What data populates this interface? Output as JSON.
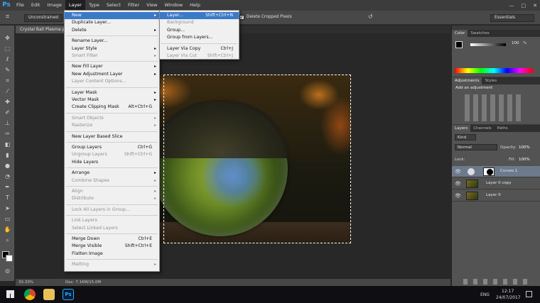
{
  "app": {
    "logo": "Ps"
  },
  "menubar": {
    "items": [
      "File",
      "Edit",
      "Image",
      "Layer",
      "Type",
      "Select",
      "Filter",
      "View",
      "Window",
      "Help"
    ],
    "window_controls": [
      "—",
      "□",
      "✕"
    ]
  },
  "options_bar": {
    "constrain_mode": "Unconstrained",
    "delete_cropped_label": "Delete Cropped Pixels",
    "workspace": "Essentials"
  },
  "document": {
    "tab_title": "Crystal Ball Plasma.ps..."
  },
  "status": {
    "zoom": "33.33%",
    "doc_info": "Doc: 7.16M/15.0M"
  },
  "layer_menu": {
    "items": [
      {
        "label": "New",
        "has_submenu": true,
        "highlight": true
      },
      {
        "label": "Duplicate Layer...",
        "has_submenu": false
      },
      {
        "label": "Delete",
        "has_submenu": true
      },
      {
        "sep": true
      },
      {
        "label": "Rename Layer...",
        "has_submenu": false
      },
      {
        "label": "Layer Style",
        "has_submenu": true
      },
      {
        "label": "Smart Filter",
        "has_submenu": true,
        "disabled": true
      },
      {
        "sep": true
      },
      {
        "label": "New Fill Layer",
        "has_submenu": true
      },
      {
        "label": "New Adjustment Layer",
        "has_submenu": true
      },
      {
        "label": "Layer Content Options...",
        "disabled": true
      },
      {
        "sep": true
      },
      {
        "label": "Layer Mask",
        "has_submenu": true
      },
      {
        "label": "Vector Mask",
        "has_submenu": true
      },
      {
        "label": "Create Clipping Mask",
        "shortcut": "Alt+Ctrl+G"
      },
      {
        "sep": true
      },
      {
        "label": "Smart Objects",
        "has_submenu": true,
        "disabled": true
      },
      {
        "label": "Rasterize",
        "has_submenu": true,
        "disabled": true
      },
      {
        "sep": true
      },
      {
        "label": "New Layer Based Slice"
      },
      {
        "sep": true
      },
      {
        "label": "Group Layers",
        "shortcut": "Ctrl+G"
      },
      {
        "label": "Ungroup Layers",
        "shortcut": "Shift+Ctrl+G",
        "disabled": true
      },
      {
        "label": "Hide Layers"
      },
      {
        "sep": true
      },
      {
        "label": "Arrange",
        "has_submenu": true
      },
      {
        "label": "Combine Shapes",
        "has_submenu": true,
        "disabled": true
      },
      {
        "sep": true
      },
      {
        "label": "Align",
        "has_submenu": true,
        "disabled": true
      },
      {
        "label": "Distribute",
        "has_submenu": true,
        "disabled": true
      },
      {
        "sep": true
      },
      {
        "label": "Lock All Layers in Group...",
        "disabled": true
      },
      {
        "sep": true
      },
      {
        "label": "Link Layers",
        "disabled": true
      },
      {
        "label": "Select Linked Layers",
        "disabled": true
      },
      {
        "sep": true
      },
      {
        "label": "Merge Down",
        "shortcut": "Ctrl+E"
      },
      {
        "label": "Merge Visible",
        "shortcut": "Shift+Ctrl+E"
      },
      {
        "label": "Flatten Image"
      },
      {
        "sep": true
      },
      {
        "label": "Matting",
        "has_submenu": true,
        "disabled": true
      }
    ]
  },
  "new_submenu": {
    "items": [
      {
        "label": "Layer...",
        "shortcut": "Shift+Ctrl+N",
        "highlight": true
      },
      {
        "label": "Background",
        "disabled": true
      },
      {
        "label": "Group..."
      },
      {
        "label": "Group from Layers..."
      },
      {
        "sep": true
      },
      {
        "label": "Layer Via Copy",
        "shortcut": "Ctrl+J"
      },
      {
        "label": "Layer Via Cut",
        "shortcut": "Shift+Ctrl+J",
        "disabled": true
      }
    ]
  },
  "color_panel": {
    "tabs": [
      "Color",
      "Swatches"
    ],
    "k_value": "100",
    "unit": "%"
  },
  "adjustments_panel": {
    "tabs": [
      "Adjustments",
      "Styles"
    ],
    "header": "Add an adjustment"
  },
  "layers_panel": {
    "tabs": [
      "Layers",
      "Channels",
      "Paths"
    ],
    "filter_kind": "Kind",
    "blend_mode": "Normal",
    "opacity_label": "Opacity:",
    "opacity_value": "100%",
    "lock_label": "Lock:",
    "fill_label": "Fill:",
    "fill_value": "100%",
    "layers": [
      {
        "name": "Curves 1",
        "selected": true,
        "type": "adjustment"
      },
      {
        "name": "Layer 0 copy",
        "selected": false,
        "type": "image"
      },
      {
        "name": "Layer 0",
        "selected": false,
        "type": "image"
      }
    ]
  },
  "taskbar": {
    "language": "ENG",
    "time": "12:17",
    "date": "24/07/2017",
    "ps_label": "Ps"
  }
}
